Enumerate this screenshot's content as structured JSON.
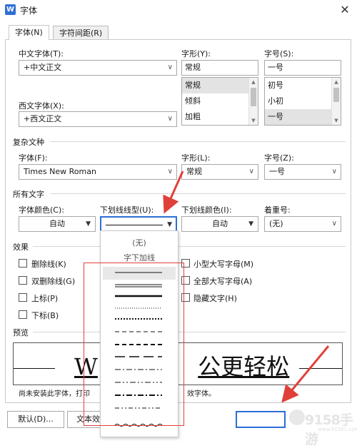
{
  "window": {
    "app_icon": "W",
    "title": "字体"
  },
  "tabs": [
    {
      "label": "字体(N)"
    },
    {
      "label": "字符间距(R)"
    }
  ],
  "chinese_font": {
    "label": "中文字体(T):",
    "value": "+中文正文"
  },
  "western_font": {
    "label": "西文字体(X):",
    "value": "+西文正文"
  },
  "style": {
    "label": "字形(Y):",
    "value": "常规",
    "options": [
      "常规",
      "倾斜",
      "加粗"
    ]
  },
  "size": {
    "label": "字号(S):",
    "value": "一号",
    "options": [
      "初号",
      "小初",
      "一号"
    ]
  },
  "complex": {
    "section": "复杂文种",
    "font_label": "字体(F):",
    "font_value": "Times New Roman",
    "style_label": "字形(L):",
    "style_value": "常规",
    "size_label": "字号(Z):",
    "size_value": "一号"
  },
  "all_text": {
    "section": "所有文字",
    "font_color_label": "字体颜色(C):",
    "font_color_value": "自动",
    "underline_type_label": "下划线线型(U):",
    "underline_color_label": "下划线颜色(I):",
    "underline_color_value": "自动",
    "emphasis_label": "着重号:",
    "emphasis_value": "(无)"
  },
  "effects": {
    "section": "效果",
    "items": [
      "删除线(K)",
      "双删除线(G)",
      "上标(P)",
      "下标(B)",
      "小型大写字母(M)",
      "全部大写字母(A)",
      "隐藏文字(H)"
    ]
  },
  "underline_menu": {
    "none": "(无)",
    "words_only": "字下加线"
  },
  "preview": {
    "section": "预览",
    "sample_left": "W",
    "sample_right": "公更轻松",
    "note_left": "尚未安装此字体，打印",
    "note_right": "效字体。"
  },
  "buttons": {
    "default": "默认(D)...",
    "text_effects": "文本效果"
  },
  "watermark": {
    "text": "9158手游",
    "sub": "www.91581.com"
  },
  "colors": {
    "accent": "#2b6fd7",
    "annotation_red": "#e0403a",
    "selection": "#e3e3e3"
  }
}
